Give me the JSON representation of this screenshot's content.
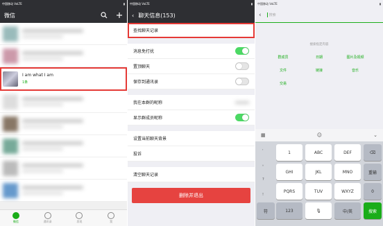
{
  "panel1": {
    "status": "中国移动 VoLTE",
    "title": "微信",
    "highlight_chat": {
      "title": "I am what I am",
      "sub": "1条"
    },
    "tabs": [
      {
        "label": "微信"
      },
      {
        "label": "通讯录"
      },
      {
        "label": "发现"
      },
      {
        "label": "我"
      }
    ]
  },
  "panel2": {
    "status": "中国移动 VoLTE",
    "title": "聊天信息(153)",
    "rows": {
      "find_history": "查找聊天记录",
      "dnd": "消息免打扰",
      "pin": "置顶聊天",
      "save_contacts": "保存到通讯录",
      "my_nickname": "我在本群的昵称",
      "show_nicknames": "显示群成员昵称",
      "set_background": "设置当前聊天背景",
      "complain": "投诉",
      "clear_history": "清空聊天记录"
    },
    "delete_button": "删除并退出"
  },
  "panel3": {
    "status": "中国移动 VoLTE",
    "search_placeholder": "搜索",
    "hint": "搜索指定内容",
    "links": [
      "群成员",
      "日期",
      "图片及视频",
      "文件",
      "链接",
      "音乐",
      "交易"
    ],
    "keyboard": {
      "row1": [
        "1",
        "ABC",
        "DEF"
      ],
      "row2": [
        "GHI",
        "JKL",
        "MNO"
      ],
      "row3": [
        "PQRS",
        "TUV",
        "WXYZ"
      ],
      "side": [
        ",",
        "。",
        "?",
        "!"
      ],
      "reenter": "重输",
      "zero": "0",
      "symbols": "符",
      "numbers": "123",
      "lang": "中/英",
      "search_key": "搜索"
    }
  }
}
